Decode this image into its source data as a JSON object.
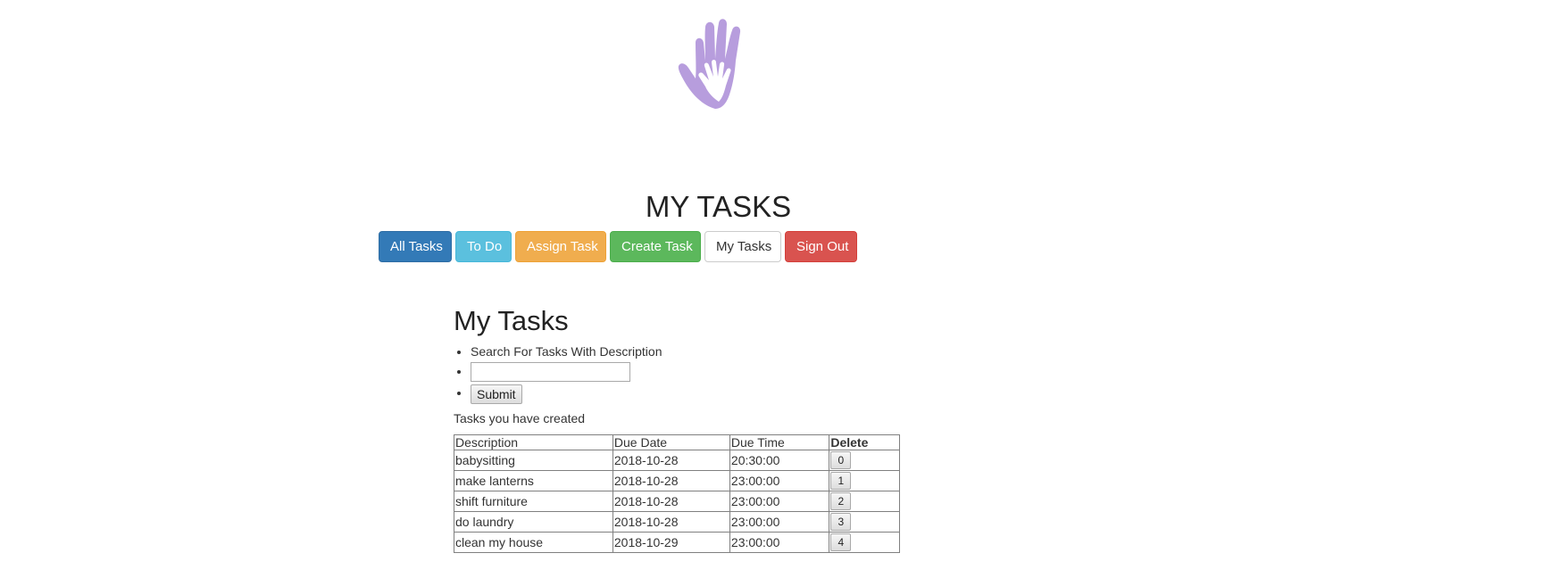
{
  "header": {
    "logo_icon": "hand-logo-icon",
    "logo_color": "#b79ddd",
    "title": "MY TASKS"
  },
  "nav": {
    "all_tasks": "All Tasks",
    "to_do": "To Do",
    "assign_task": "Assign Task",
    "create_task": "Create Task",
    "my_tasks": "My Tasks",
    "sign_out": "Sign Out"
  },
  "main": {
    "section_title": "My Tasks",
    "search_label": "Search For Tasks With Description",
    "search_value": "",
    "submit_label": "Submit",
    "created_label": "Tasks you have created",
    "table": {
      "headers": [
        "Description",
        "Due Date",
        "Due Time",
        "Delete"
      ],
      "rows": [
        {
          "description": "babysitting",
          "due_date": "2018-10-28",
          "due_time": "20:30:00",
          "delete": "0"
        },
        {
          "description": "make lanterns",
          "due_date": "2018-10-28",
          "due_time": "23:00:00",
          "delete": "1"
        },
        {
          "description": "shift furniture",
          "due_date": "2018-10-28",
          "due_time": "23:00:00",
          "delete": "2"
        },
        {
          "description": "do laundry",
          "due_date": "2018-10-28",
          "due_time": "23:00:00",
          "delete": "3"
        },
        {
          "description": "clean my house",
          "due_date": "2018-10-29",
          "due_time": "23:00:00",
          "delete": "4"
        }
      ]
    }
  }
}
